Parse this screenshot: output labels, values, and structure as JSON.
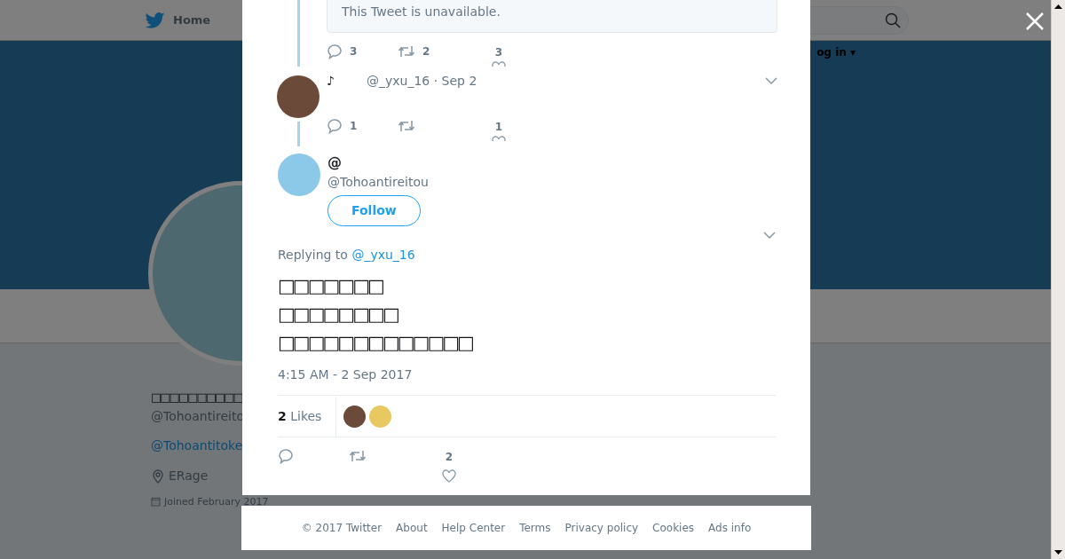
{
  "page": {
    "nav": {
      "home": "Home",
      "login": "og in ▾"
    },
    "profile": {
      "name": "□□□□□□□□□□",
      "handle": "@Tohoantireito",
      "link": "@Tohoantitoke",
      "location": "ERage",
      "joined": "Joined February 2017"
    }
  },
  "thread": [
    {
      "kind": "unavailable",
      "notice": "This Tweet is unavailable.",
      "replies": "3",
      "retweets": "2",
      "likes": "3"
    },
    {
      "kind": "tweet",
      "name": "♪",
      "meta": "@_yxu_16 · Sep 2",
      "replies": "1",
      "likes": "1"
    }
  ],
  "tweet": {
    "name": "@",
    "handle": "@Tohoantireitou",
    "follow": "Follow",
    "replying_prefix": "Replying to",
    "replying_to": "@_yxu_16",
    "lines": [
      "□□□□□□□",
      "□□□□□□□□",
      "□□□□□□□□□□□□□"
    ],
    "timestamp": "4:15 AM - 2 Sep 2017",
    "likes_count": "2",
    "likes_label": "Likes",
    "like_count": "2"
  },
  "footer": [
    "© 2017 Twitter",
    "About",
    "Help Center",
    "Terms",
    "Privacy policy",
    "Cookies",
    "Ads info"
  ]
}
